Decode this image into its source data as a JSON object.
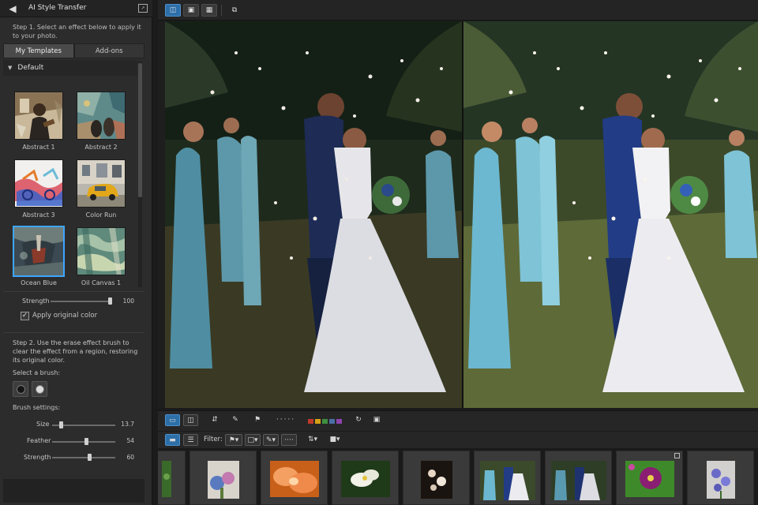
{
  "panel": {
    "title": "AI Style Transfer",
    "step1": "Step 1. Select an effect below to apply it to your photo.",
    "tabs": [
      {
        "label": "My Templates",
        "active": true
      },
      {
        "label": "Add-ons",
        "active": false
      }
    ],
    "group": "Default",
    "templates": [
      {
        "label": "Abstract 1",
        "selected": false
      },
      {
        "label": "Abstract 2",
        "selected": false
      },
      {
        "label": "Abstract 3",
        "selected": false
      },
      {
        "label": "Color Run",
        "selected": false
      },
      {
        "label": "Ocean Blue",
        "selected": true
      },
      {
        "label": "Oil Canvas 1",
        "selected": false
      }
    ],
    "strength": {
      "label": "Strength",
      "value": "100",
      "fraction": 1.0
    },
    "apply_original_color": {
      "label": "Apply original color",
      "checked": true
    },
    "step2": "Step 2. Use the erase effect brush to clear the effect from a region, restoring its original color.",
    "select_brush_label": "Select a brush:",
    "brush_settings_label": "Brush settings:",
    "brush": {
      "size": {
        "label": "Size",
        "value": "13.7",
        "fraction": 0.12
      },
      "feather": {
        "label": "Feather",
        "value": "54",
        "fraction": 0.54
      },
      "strength": {
        "label": "Strength",
        "value": "60",
        "fraction": 0.6
      }
    }
  },
  "toolbar": {
    "icons": [
      "before-after-view-icon",
      "single-photo-view-icon",
      "grid-view-icon",
      "second-display-icon"
    ]
  },
  "bottom": {
    "filter_label": "Filter:",
    "color_labels": [
      "#c0392b",
      "#d4a017",
      "#3f8f3f",
      "#4a6fa5",
      "#8e44ad"
    ]
  },
  "colors": {
    "accent": "#3ea5ff",
    "active_button": "#2d6fa8"
  }
}
